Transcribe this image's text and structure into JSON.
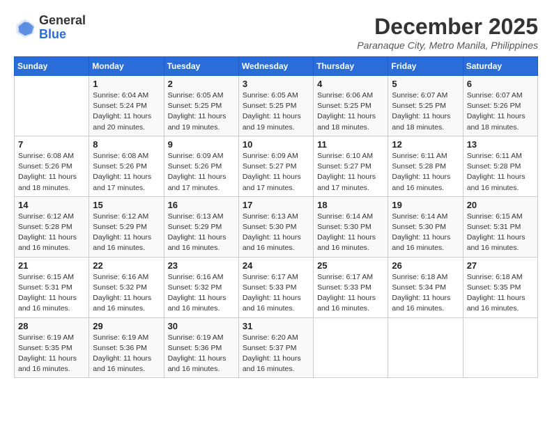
{
  "logo": {
    "line1": "General",
    "line2": "Blue"
  },
  "title": "December 2025",
  "location": "Paranaque City, Metro Manila, Philippines",
  "days_header": [
    "Sunday",
    "Monday",
    "Tuesday",
    "Wednesday",
    "Thursday",
    "Friday",
    "Saturday"
  ],
  "weeks": [
    [
      {
        "day": "",
        "info": ""
      },
      {
        "day": "1",
        "info": "Sunrise: 6:04 AM\nSunset: 5:24 PM\nDaylight: 11 hours\nand 20 minutes."
      },
      {
        "day": "2",
        "info": "Sunrise: 6:05 AM\nSunset: 5:25 PM\nDaylight: 11 hours\nand 19 minutes."
      },
      {
        "day": "3",
        "info": "Sunrise: 6:05 AM\nSunset: 5:25 PM\nDaylight: 11 hours\nand 19 minutes."
      },
      {
        "day": "4",
        "info": "Sunrise: 6:06 AM\nSunset: 5:25 PM\nDaylight: 11 hours\nand 18 minutes."
      },
      {
        "day": "5",
        "info": "Sunrise: 6:07 AM\nSunset: 5:25 PM\nDaylight: 11 hours\nand 18 minutes."
      },
      {
        "day": "6",
        "info": "Sunrise: 6:07 AM\nSunset: 5:26 PM\nDaylight: 11 hours\nand 18 minutes."
      }
    ],
    [
      {
        "day": "7",
        "info": "Sunrise: 6:08 AM\nSunset: 5:26 PM\nDaylight: 11 hours\nand 18 minutes."
      },
      {
        "day": "8",
        "info": "Sunrise: 6:08 AM\nSunset: 5:26 PM\nDaylight: 11 hours\nand 17 minutes."
      },
      {
        "day": "9",
        "info": "Sunrise: 6:09 AM\nSunset: 5:26 PM\nDaylight: 11 hours\nand 17 minutes."
      },
      {
        "day": "10",
        "info": "Sunrise: 6:09 AM\nSunset: 5:27 PM\nDaylight: 11 hours\nand 17 minutes."
      },
      {
        "day": "11",
        "info": "Sunrise: 6:10 AM\nSunset: 5:27 PM\nDaylight: 11 hours\nand 17 minutes."
      },
      {
        "day": "12",
        "info": "Sunrise: 6:11 AM\nSunset: 5:28 PM\nDaylight: 11 hours\nand 16 minutes."
      },
      {
        "day": "13",
        "info": "Sunrise: 6:11 AM\nSunset: 5:28 PM\nDaylight: 11 hours\nand 16 minutes."
      }
    ],
    [
      {
        "day": "14",
        "info": "Sunrise: 6:12 AM\nSunset: 5:28 PM\nDaylight: 11 hours\nand 16 minutes."
      },
      {
        "day": "15",
        "info": "Sunrise: 6:12 AM\nSunset: 5:29 PM\nDaylight: 11 hours\nand 16 minutes."
      },
      {
        "day": "16",
        "info": "Sunrise: 6:13 AM\nSunset: 5:29 PM\nDaylight: 11 hours\nand 16 minutes."
      },
      {
        "day": "17",
        "info": "Sunrise: 6:13 AM\nSunset: 5:30 PM\nDaylight: 11 hours\nand 16 minutes."
      },
      {
        "day": "18",
        "info": "Sunrise: 6:14 AM\nSunset: 5:30 PM\nDaylight: 11 hours\nand 16 minutes."
      },
      {
        "day": "19",
        "info": "Sunrise: 6:14 AM\nSunset: 5:30 PM\nDaylight: 11 hours\nand 16 minutes."
      },
      {
        "day": "20",
        "info": "Sunrise: 6:15 AM\nSunset: 5:31 PM\nDaylight: 11 hours\nand 16 minutes."
      }
    ],
    [
      {
        "day": "21",
        "info": "Sunrise: 6:15 AM\nSunset: 5:31 PM\nDaylight: 11 hours\nand 16 minutes."
      },
      {
        "day": "22",
        "info": "Sunrise: 6:16 AM\nSunset: 5:32 PM\nDaylight: 11 hours\nand 16 minutes."
      },
      {
        "day": "23",
        "info": "Sunrise: 6:16 AM\nSunset: 5:32 PM\nDaylight: 11 hours\nand 16 minutes."
      },
      {
        "day": "24",
        "info": "Sunrise: 6:17 AM\nSunset: 5:33 PM\nDaylight: 11 hours\nand 16 minutes."
      },
      {
        "day": "25",
        "info": "Sunrise: 6:17 AM\nSunset: 5:33 PM\nDaylight: 11 hours\nand 16 minutes."
      },
      {
        "day": "26",
        "info": "Sunrise: 6:18 AM\nSunset: 5:34 PM\nDaylight: 11 hours\nand 16 minutes."
      },
      {
        "day": "27",
        "info": "Sunrise: 6:18 AM\nSunset: 5:35 PM\nDaylight: 11 hours\nand 16 minutes."
      }
    ],
    [
      {
        "day": "28",
        "info": "Sunrise: 6:19 AM\nSunset: 5:35 PM\nDaylight: 11 hours\nand 16 minutes."
      },
      {
        "day": "29",
        "info": "Sunrise: 6:19 AM\nSunset: 5:36 PM\nDaylight: 11 hours\nand 16 minutes."
      },
      {
        "day": "30",
        "info": "Sunrise: 6:19 AM\nSunset: 5:36 PM\nDaylight: 11 hours\nand 16 minutes."
      },
      {
        "day": "31",
        "info": "Sunrise: 6:20 AM\nSunset: 5:37 PM\nDaylight: 11 hours\nand 16 minutes."
      },
      {
        "day": "",
        "info": ""
      },
      {
        "day": "",
        "info": ""
      },
      {
        "day": "",
        "info": ""
      }
    ]
  ]
}
